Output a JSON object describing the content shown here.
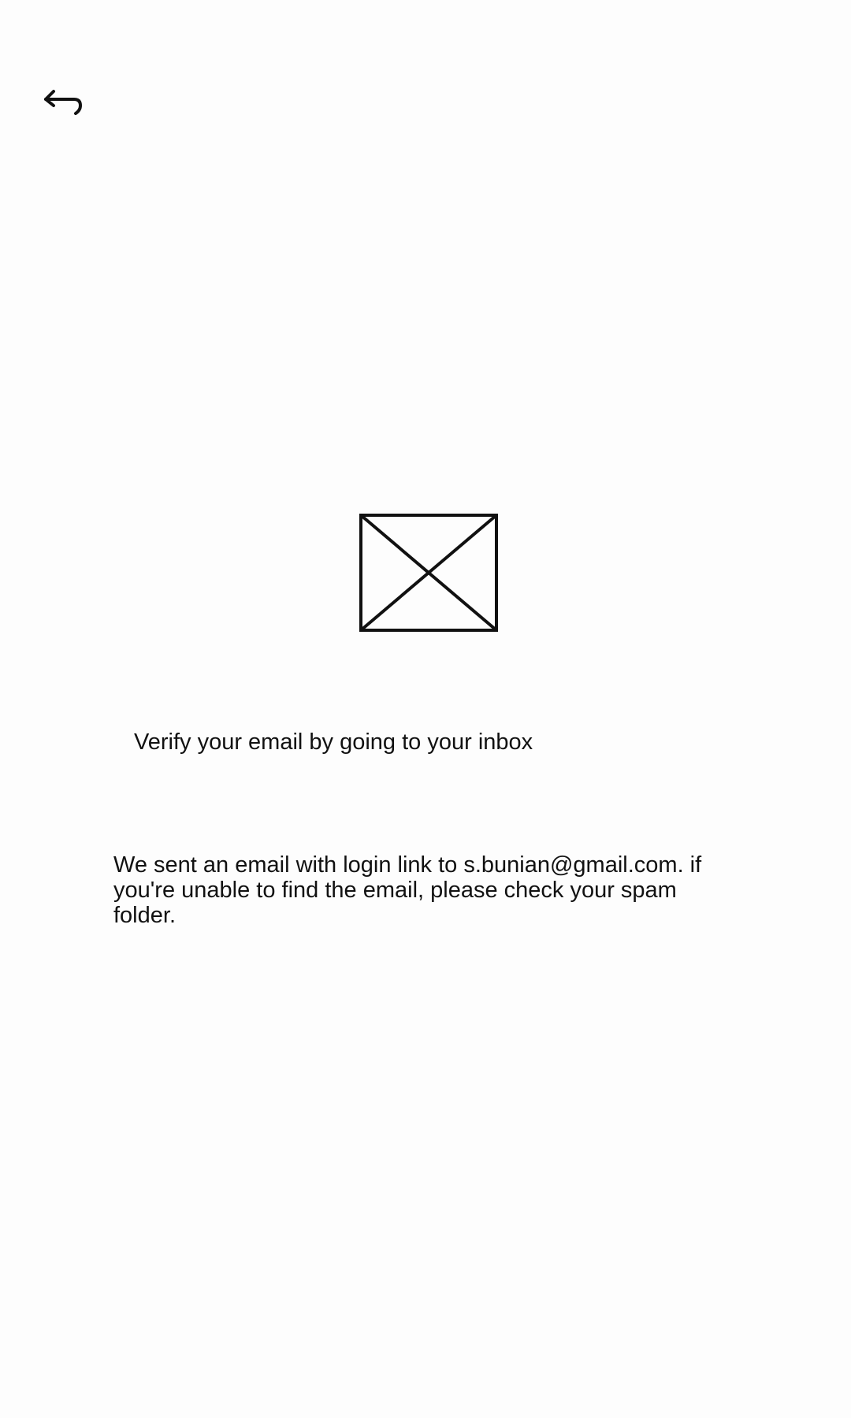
{
  "header": {
    "back_icon": "back-arrow-icon"
  },
  "illustration": {
    "icon": "image-placeholder-icon"
  },
  "content": {
    "heading": "Verify your email by going to your inbox",
    "message": "We sent an email with login link to s.bunian@gmail.com. if you're unable to find the email, please check your spam folder."
  }
}
